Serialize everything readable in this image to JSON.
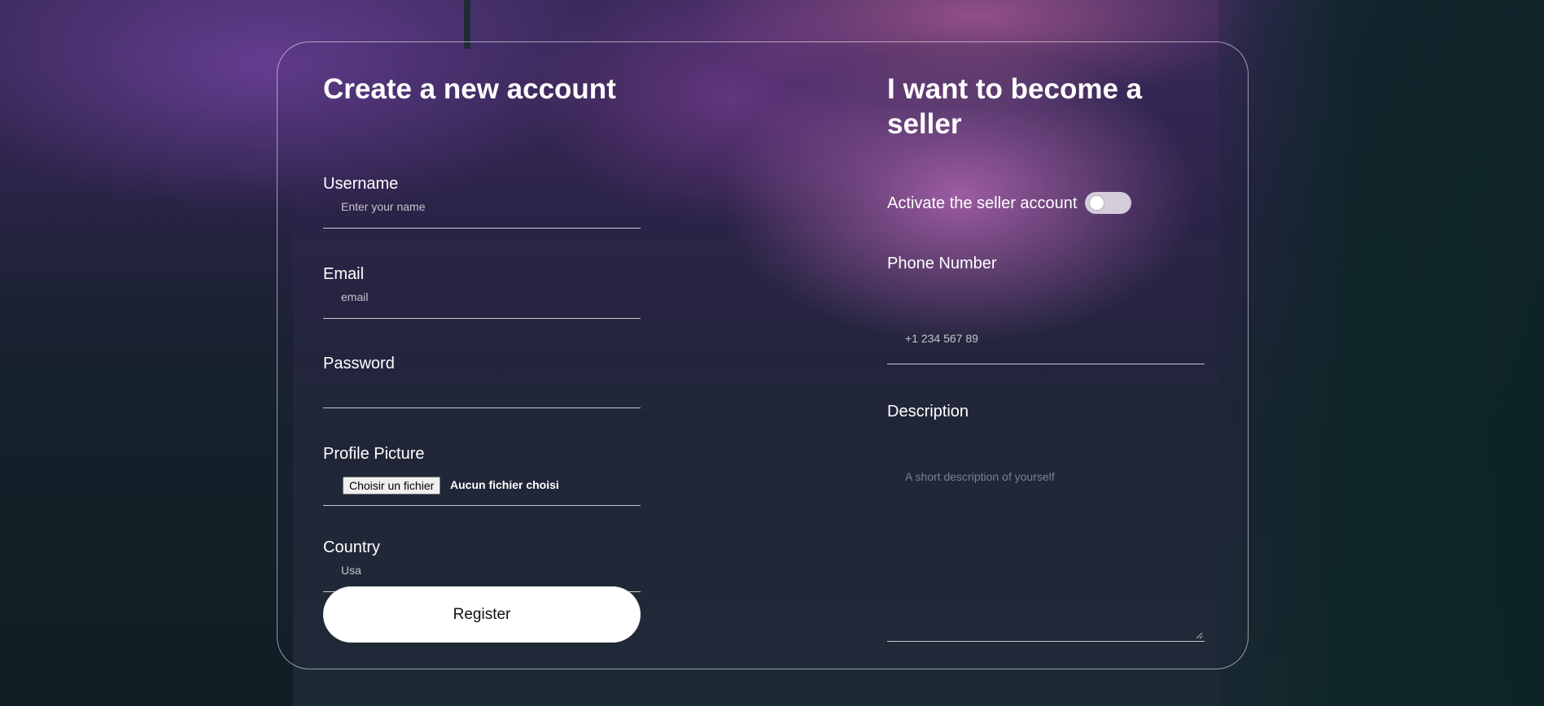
{
  "colors": {
    "card_border": "#ffffff",
    "button_bg": "#ffffff",
    "accent_glow": "#d678cd"
  },
  "signup": {
    "title": "Create a new account",
    "username": {
      "label": "Username",
      "placeholder": "Enter your name"
    },
    "email": {
      "label": "Email",
      "placeholder": "email"
    },
    "password": {
      "label": "Password",
      "placeholder": ""
    },
    "profile_picture": {
      "label": "Profile Picture",
      "button": "Choisir un fichier",
      "status": "Aucun fichier choisi"
    },
    "country": {
      "label": "Country",
      "placeholder": "Usa"
    },
    "register_label": "Register"
  },
  "seller": {
    "title": "I want to become a seller",
    "toggle_label": "Activate the seller account",
    "toggle_on": false,
    "phone": {
      "label": "Phone Number",
      "placeholder": "+1 234 567 89"
    },
    "description": {
      "label": "Description",
      "placeholder": "A short description of yourself"
    }
  }
}
